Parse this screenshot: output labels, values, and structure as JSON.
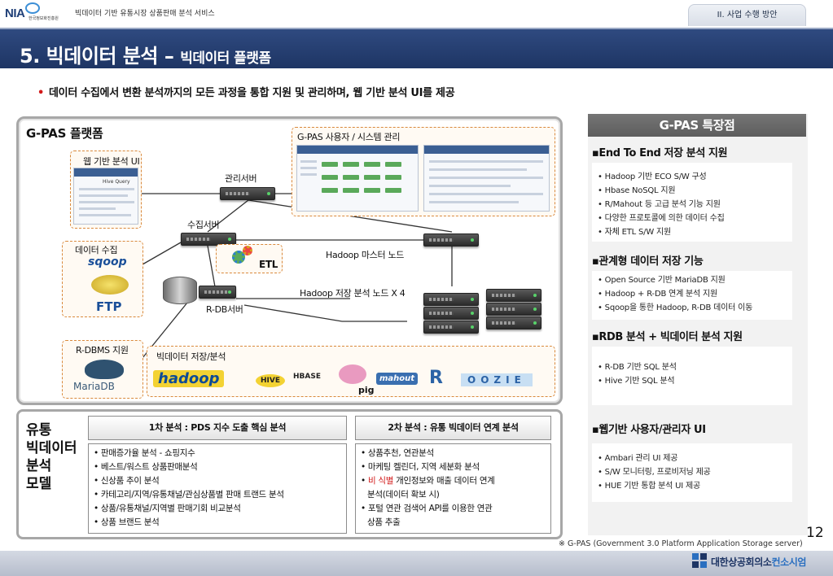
{
  "header": {
    "org_short": "NIA",
    "org_full": "한국정보화진흥원",
    "doc_title": "빅데이터 기반 유통시장 상품판매 분석 서비스",
    "section_tab": "II. 사업 수행 방안"
  },
  "title": {
    "main": "5. 빅데이터 분석 –",
    "sub": "빅데이터 플랫폼"
  },
  "intro_bullet": "데이터 수집에서 변환 분석까지의 모든 과정을 통합 지원 및 관리하며, 웹 기반 분석 UI를 제공",
  "platform": {
    "title": "G-PAS  플랫폼",
    "web_ui_label": "웹 기반 분석 UI",
    "web_ui_query_title": "Hive Query",
    "sysadmin_label": "G-PAS 사용자 / 시스템 관리",
    "mgmt_server": "관리서버",
    "collect_server": "수집서버",
    "data_collect": "데이터 수집",
    "etl": "ETL",
    "hadoop_master": "Hadoop 마스터 노드",
    "hadoop_storage": "Hadoop 저장 분석 노드 X 4",
    "rdb_server": "R-DB서버",
    "rdbms": "R-DBMS 지원",
    "bigdata_storage": "빅데이터 저장/분석",
    "logos": {
      "sqoop": "sqoop",
      "ftp": "FTP",
      "mariadb": "MariaDB",
      "hadoop": "hadoop",
      "hive": "HIVE",
      "hbase": "HBASE",
      "pig": "pig",
      "mahout": "mahout",
      "r": "R",
      "oozie": "OOZIE"
    }
  },
  "gpas_features": {
    "header": "G-PAS 특장점",
    "groups": [
      {
        "title": "▪End To End 저장 분석 지원",
        "items": [
          "• Hadoop 기반 ECO S/W 구성",
          "• Hbase NoSQL 지원",
          "• R/Mahout 등 고급 분석 기능 지원",
          "• 다양한 프로토콜에 의한 데이터 수집",
          "• 자체 ETL S/W 지원"
        ]
      },
      {
        "title": "▪관계형 데이터 저장 기능",
        "items": [
          "• Open Source 기반 MariaDB 지원",
          "• Hadoop + R-DB 연계 분석 지원",
          "• Sqoop을 통한 Hadoop, R-DB 데이터 이동"
        ]
      },
      {
        "title": "▪RDB 분석 + 빅데이터 분석 지원",
        "items": [
          "• R-DB 기반 SQL 분석",
          "• Hive 기반 SQL 분석"
        ]
      },
      {
        "title": "▪웹기반 사용자/관리자 UI",
        "items": [
          "• Ambari 관리 UI 제공",
          "• S/W 모니터링, 프로비저닝 제공",
          "• HUE 기반 통합 분석 UI 제공"
        ]
      }
    ]
  },
  "analysis_model": {
    "title_lines": [
      "유통",
      "빅데이터",
      "분석",
      "모델"
    ],
    "col1": {
      "head": "1차 분석 : PDS 지수 도출 핵심 분석",
      "items": [
        "• 판매증가율 분석 - 쇼핑지수",
        "• 베스트/워스트 상품판매분석",
        "• 신상품 추이 분석",
        "• 카테고리/지역/유통채널/관심상품별 판매 트랜드 분석",
        "• 상품/유통채널/지역별 판매기회 비교분석",
        "• 상품 브랜드 분석"
      ]
    },
    "col2": {
      "head": "2차 분석 : 유통 빅데이터 연계 분석",
      "items": [
        "• 상품추천, 연관분석",
        "• 마케팅 켈린더, 지역 세분화 분석"
      ],
      "item3_prefix": "• ",
      "item3_red": "비 식별",
      "item3_rest": " 개인정보와 매출 데이터 연계",
      "item3_line2": "분석(데이터 확보 시)",
      "item4_line1": "• 포털 연관 검색어 API를 이용한 연관",
      "item4_line2": "상품 추출"
    }
  },
  "footnote": "※ G-PAS (Government 3.0 Platform Application Storage server)",
  "page_number": "12",
  "footer_logo": {
    "name": "대한상공회의소",
    "sub": "컨소시엄"
  },
  "colors": {
    "title_band": "#1e3564",
    "accent_red": "#d21a1a",
    "dash_orange": "#d9893c",
    "feature_header": "#666666"
  }
}
